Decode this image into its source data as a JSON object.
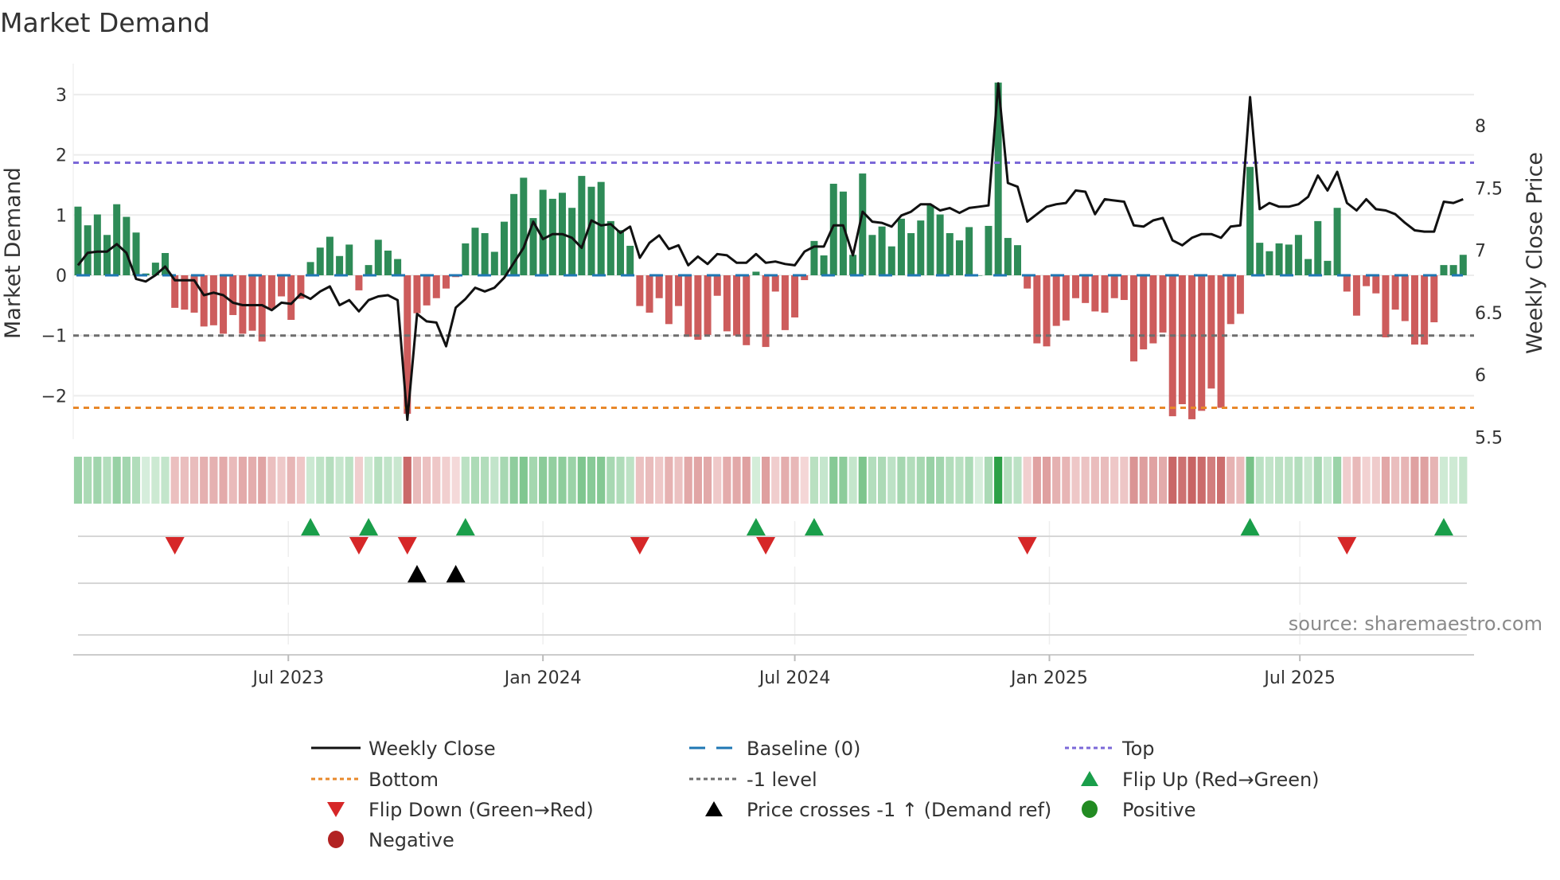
{
  "chart_data": {
    "type": "bar",
    "title": "Market Demand",
    "ylabel": "Market Demand",
    "y2label": "Weekly Close Price",
    "ylim": [
      -2.7,
      3.5
    ],
    "y2lim": [
      5.45,
      8.5
    ],
    "yticks": [
      "3",
      "2",
      "1",
      "0",
      "−1",
      "−2"
    ],
    "ytick_values": [
      3,
      2,
      1,
      0,
      -1,
      -2
    ],
    "y2ticks": [
      "8",
      "7.5",
      "7",
      "6.5",
      "6",
      "5.5"
    ],
    "y2tick_values": [
      8,
      7.5,
      7,
      6.5,
      6,
      5.5
    ],
    "xticks": [
      {
        "label": "Jul 2023",
        "date": "2023-07-01"
      },
      {
        "label": "Jan 2024",
        "date": "2024-01-01"
      },
      {
        "label": "Jul 2024",
        "date": "2024-07-01"
      },
      {
        "label": "Jan 2025",
        "date": "2025-01-01"
      },
      {
        "label": "Jul 2025",
        "date": "2025-07-01"
      }
    ],
    "start_date": "2023-01-30",
    "interval_days": 7,
    "grid": true,
    "levels": {
      "top": 1.87,
      "bottom": -2.2,
      "minus_one": -1,
      "baseline": 0
    },
    "demand": [
      1.14,
      0.83,
      1.01,
      0.67,
      1.18,
      0.97,
      0.71,
      0.03,
      0.21,
      0.37,
      -0.54,
      -0.57,
      -0.62,
      -0.85,
      -0.83,
      -0.97,
      -0.66,
      -0.97,
      -0.92,
      -1.1,
      -0.55,
      -0.35,
      -0.74,
      -0.39,
      0.22,
      0.46,
      0.64,
      0.32,
      0.51,
      -0.25,
      0.17,
      0.59,
      0.41,
      0.27,
      -2.3,
      -0.63,
      -0.5,
      -0.38,
      -0.22,
      -0.03,
      0.53,
      0.79,
      0.7,
      0.39,
      0.89,
      1.35,
      1.62,
      0.95,
      1.42,
      1.27,
      1.37,
      1.12,
      1.65,
      1.47,
      1.55,
      0.9,
      0.75,
      0.49,
      -0.51,
      -0.62,
      -0.38,
      -0.81,
      -0.51,
      -1.02,
      -1.07,
      -0.99,
      -0.34,
      -0.93,
      -1.0,
      -1.16,
      0.06,
      -1.19,
      -0.27,
      -0.91,
      -0.7,
      -0.08,
      0.57,
      0.33,
      1.52,
      1.39,
      0.34,
      1.69,
      0.67,
      0.81,
      0.48,
      0.94,
      0.7,
      0.91,
      1.17,
      1.01,
      0.7,
      0.58,
      0.8,
      0.0,
      0.82,
      3.2,
      0.62,
      0.5,
      -0.22,
      -1.13,
      -1.18,
      -0.84,
      -0.75,
      -0.38,
      -0.46,
      -0.6,
      -0.62,
      -0.38,
      -0.41,
      -1.43,
      -1.23,
      -1.13,
      -0.95,
      -2.34,
      -2.14,
      -2.39,
      -2.25,
      -1.88,
      -2.2,
      -0.81,
      -0.64,
      1.8,
      0.54,
      0.4,
      0.53,
      0.51,
      0.67,
      0.27,
      0.9,
      0.24,
      1.12,
      -0.27,
      -0.67,
      -0.18,
      -0.3,
      -1.03,
      -0.57,
      -0.76,
      -1.15,
      -1.15,
      -0.78,
      0.17,
      0.17,
      0.34
    ],
    "weekly_close": [
      6.88,
      6.98,
      6.99,
      6.99,
      7.05,
      6.98,
      6.77,
      6.75,
      6.8,
      6.87,
      6.76,
      6.76,
      6.76,
      6.64,
      6.66,
      6.64,
      6.58,
      6.56,
      6.56,
      6.56,
      6.52,
      6.58,
      6.57,
      6.65,
      6.61,
      6.67,
      6.71,
      6.56,
      6.6,
      6.51,
      6.6,
      6.63,
      6.64,
      6.6,
      5.64,
      6.49,
      6.43,
      6.42,
      6.23,
      6.54,
      6.61,
      6.7,
      6.67,
      6.7,
      6.78,
      6.9,
      7.02,
      7.23,
      7.09,
      7.13,
      7.13,
      7.1,
      7.02,
      7.24,
      7.2,
      7.21,
      7.14,
      7.19,
      6.94,
      7.06,
      7.12,
      7.01,
      7.04,
      6.88,
      6.95,
      6.89,
      6.97,
      6.96,
      6.9,
      6.9,
      6.97,
      6.9,
      6.91,
      6.89,
      6.88,
      6.99,
      7.03,
      7.03,
      7.2,
      7.2,
      6.96,
      7.31,
      7.23,
      7.22,
      7.19,
      7.28,
      7.31,
      7.37,
      7.37,
      7.32,
      7.34,
      7.3,
      7.34,
      7.35,
      7.36,
      8.34,
      7.54,
      7.51,
      7.23,
      7.29,
      7.35,
      7.37,
      7.38,
      7.48,
      7.47,
      7.29,
      7.41,
      7.4,
      7.39,
      7.2,
      7.19,
      7.24,
      7.26,
      7.08,
      7.04,
      7.1,
      7.13,
      7.13,
      7.1,
      7.19,
      7.2,
      8.23,
      7.33,
      7.38,
      7.35,
      7.35,
      7.37,
      7.43,
      7.6,
      7.48,
      7.63,
      7.38,
      7.32,
      7.41,
      7.33,
      7.32,
      7.29,
      7.22,
      7.16,
      7.15,
      7.15,
      7.39,
      7.38,
      7.41
    ],
    "flip_up_indices": [
      24,
      30,
      40,
      70,
      76,
      121,
      141
    ],
    "flip_down_indices": [
      10,
      29,
      34,
      58,
      71,
      98,
      131
    ],
    "price_cross_indices": [
      35,
      39
    ],
    "legend_placement": "bottom",
    "legend": [
      {
        "label": "Weekly Close",
        "symbol": "line-solid",
        "color": "#111111"
      },
      {
        "label": "Baseline (0)",
        "symbol": "line-dashed",
        "color": "#1f77b4"
      },
      {
        "label": "Top",
        "symbol": "line-dotted",
        "color": "#7b68d8"
      },
      {
        "label": "Bottom",
        "symbol": "line-dotted",
        "color": "#e8882a"
      },
      {
        "label": "-1 level",
        "symbol": "line-dotted",
        "color": "#6e6e6e"
      },
      {
        "label": "Flip Up (Red→Green)",
        "symbol": "triangle-up",
        "color": "#1a9e4a"
      },
      {
        "label": "Flip Down (Green→Red)",
        "symbol": "triangle-down",
        "color": "#d62728"
      },
      {
        "label": "Price crosses -1 ↑ (Demand ref)",
        "symbol": "triangle-up",
        "color": "#000000"
      },
      {
        "label": "Positive",
        "symbol": "circle",
        "color": "#228b22"
      },
      {
        "label": "Negative",
        "symbol": "circle",
        "color": "#b22222"
      }
    ],
    "annotation": "source: sharemaestro.com"
  },
  "colors": {
    "positive_bar": "#2e8b57",
    "negative_bar": "#cd5c5c",
    "grid": "#ececec"
  }
}
